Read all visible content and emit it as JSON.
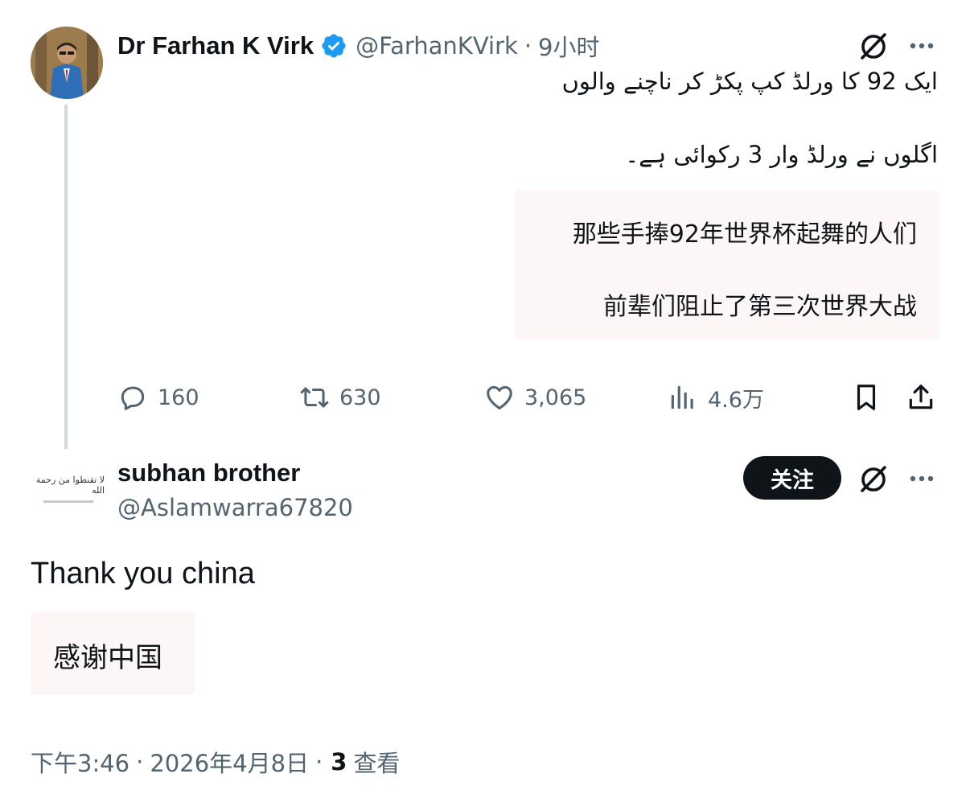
{
  "parent_tweet": {
    "author_name": "Dr Farhan K Virk",
    "verified": true,
    "handle": "@FarhanKVirk",
    "separator": "·",
    "time": "9小时",
    "urdu_line_1": "ایک 92 کا ورلڈ کپ پکڑ کر ناچنے والوں",
    "urdu_line_2": "اگلوں نے ورلڈ وار 3 رکوائی ہے۔",
    "translation_line_1": "那些手捧92年世界杯起舞的人们",
    "translation_line_2": "前辈们阻止了第三次世界大战",
    "stats": {
      "replies": "160",
      "retweets": "630",
      "likes": "3,065",
      "views": "4.6万"
    },
    "icons": [
      "grok-icon",
      "more-icon",
      "reply-icon",
      "retweet-icon",
      "like-icon",
      "views-icon",
      "bookmark-icon",
      "share-icon",
      "verified-badge-icon"
    ]
  },
  "reply_tweet": {
    "author_name": "subhan brother",
    "handle": "@Aslamwarra67820",
    "follow_label": "关注",
    "avatar_logo_text": "لا تقنطوا من رحمة الله",
    "body": "Thank you china",
    "translation": "感谢中国",
    "meta": {
      "time": "下午3:46",
      "sep1": "·",
      "date": "2026年4月8日",
      "sep2": "·",
      "views_count": "3",
      "views_label": "查看"
    }
  },
  "colors": {
    "text_primary": "#0f1419",
    "text_secondary": "#536471",
    "verified_blue": "#1d9bf0",
    "thread_line": "#cfd9de",
    "translation_bg": "#fdf6f6",
    "follow_button_bg": "#0f1419"
  }
}
